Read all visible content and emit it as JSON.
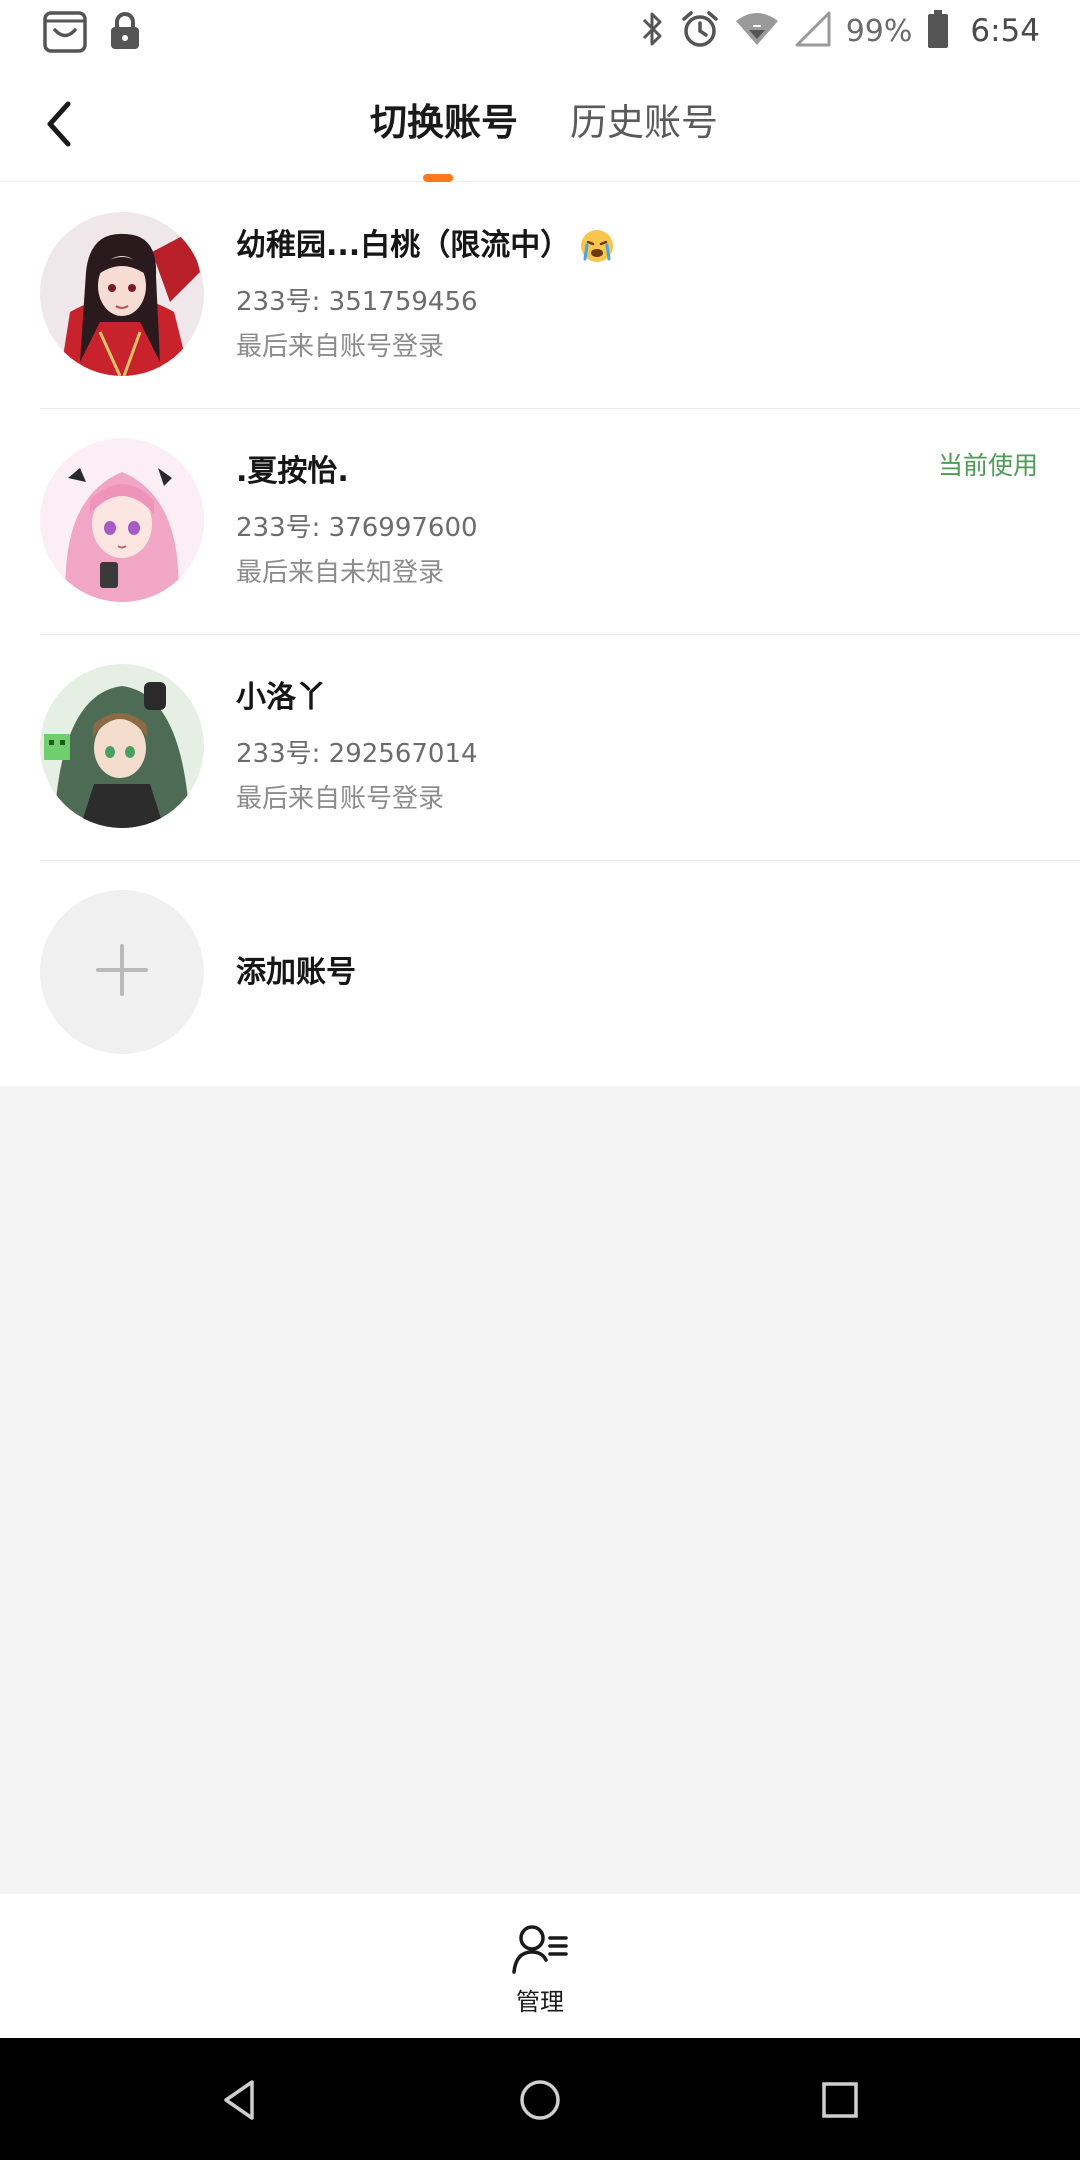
{
  "status_bar": {
    "battery": "99%",
    "time": "6:54",
    "icons": [
      "shopping-bag-icon",
      "lock-icon",
      "bluetooth-icon",
      "alarm-icon",
      "wifi-icon",
      "signal-icon",
      "battery-icon"
    ]
  },
  "header": {
    "back_icon": "chevron-left-icon",
    "tabs": [
      {
        "label": "切换账号",
        "active": true
      },
      {
        "label": "历史账号",
        "active": false
      }
    ],
    "accent_color": "#ff7a1a"
  },
  "accounts": [
    {
      "name": "幼稚园...白桃（限流中）",
      "emoji": "crying-face-emoji",
      "id": "233号: 351759456",
      "login": "最后来自账号登录",
      "current": false
    },
    {
      "name": ".夏按怡.",
      "id": "233号: 376997600",
      "login": "最后来自未知登录",
      "current": true,
      "current_label": "当前使用"
    },
    {
      "name": "小洛丫",
      "id": "233号: 292567014",
      "login": "最后来自账号登录",
      "current": false
    }
  ],
  "add_account": {
    "label": "添加账号",
    "icon": "plus-icon"
  },
  "bottom_bar": {
    "manage_label": "管理",
    "manage_icon": "user-manage-icon"
  },
  "system_nav": {
    "icons": [
      "nav-back-icon",
      "nav-home-icon",
      "nav-recents-icon"
    ]
  },
  "colors": {
    "current_badge": "#4e9a57",
    "background": "#f4f4f4"
  }
}
